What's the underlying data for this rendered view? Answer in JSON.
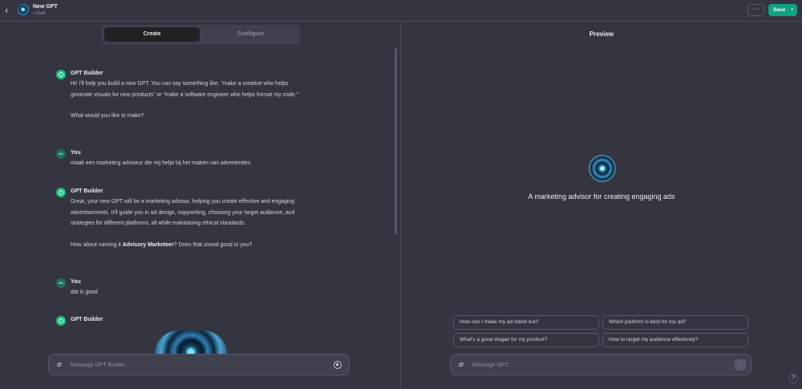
{
  "header": {
    "back_glyph": "‹",
    "title": "New GPT",
    "subtitle": "• Draft",
    "more_glyph": "···",
    "save_label": "Save",
    "save_caret": "▾",
    "accent_color": "#10a37f"
  },
  "builder": {
    "tabs": [
      {
        "label": "Create",
        "active": true
      },
      {
        "label": "Configure",
        "active": false
      }
    ],
    "messages": [
      {
        "author": "GPT Builder",
        "paragraphs": [
          "Hi! I'll help you build a new GPT. You can say something like, \"make a creative who helps generate visuals for new products\" or \"make a software engineer who helps format my code.\"",
          "What would you like to make?"
        ]
      },
      {
        "author": "You",
        "avatar_initials": "SA",
        "paragraphs": [
          "maak een marketing adviseur die mij helpt bij het maken van advertenties"
        ]
      },
      {
        "author": "GPT Builder",
        "paragraphs": [
          "Great, your new GPT will be a marketing advisor, helping you create effective and engaging advertisements. It'll guide you in ad design, copywriting, choosing your target audience, and strategies for different platforms, all while maintaining ethical standards."
        ],
        "naming_prefix": "How about naming it ",
        "naming_name": "Advisory Marketeer",
        "naming_suffix": "? Does that sound good to you?"
      },
      {
        "author": "You",
        "avatar_initials": "SA",
        "paragraphs": [
          "dat is goed"
        ]
      },
      {
        "author": "GPT Builder",
        "paragraphs": []
      }
    ],
    "composer_placeholder": "Message GPT Builder...",
    "attach_glyph": "⌀"
  },
  "preview": {
    "title": "Preview",
    "description": "A marketing advisor for creating engaging ads",
    "starters": [
      "How can I make my ad stand out?",
      "Which platform is best for my ad?",
      "What's a good slogan for my product?",
      "How to target my audience effectively?"
    ],
    "composer_placeholder": "Message GPT...",
    "send_glyph": "↑"
  },
  "help_glyph": "?"
}
